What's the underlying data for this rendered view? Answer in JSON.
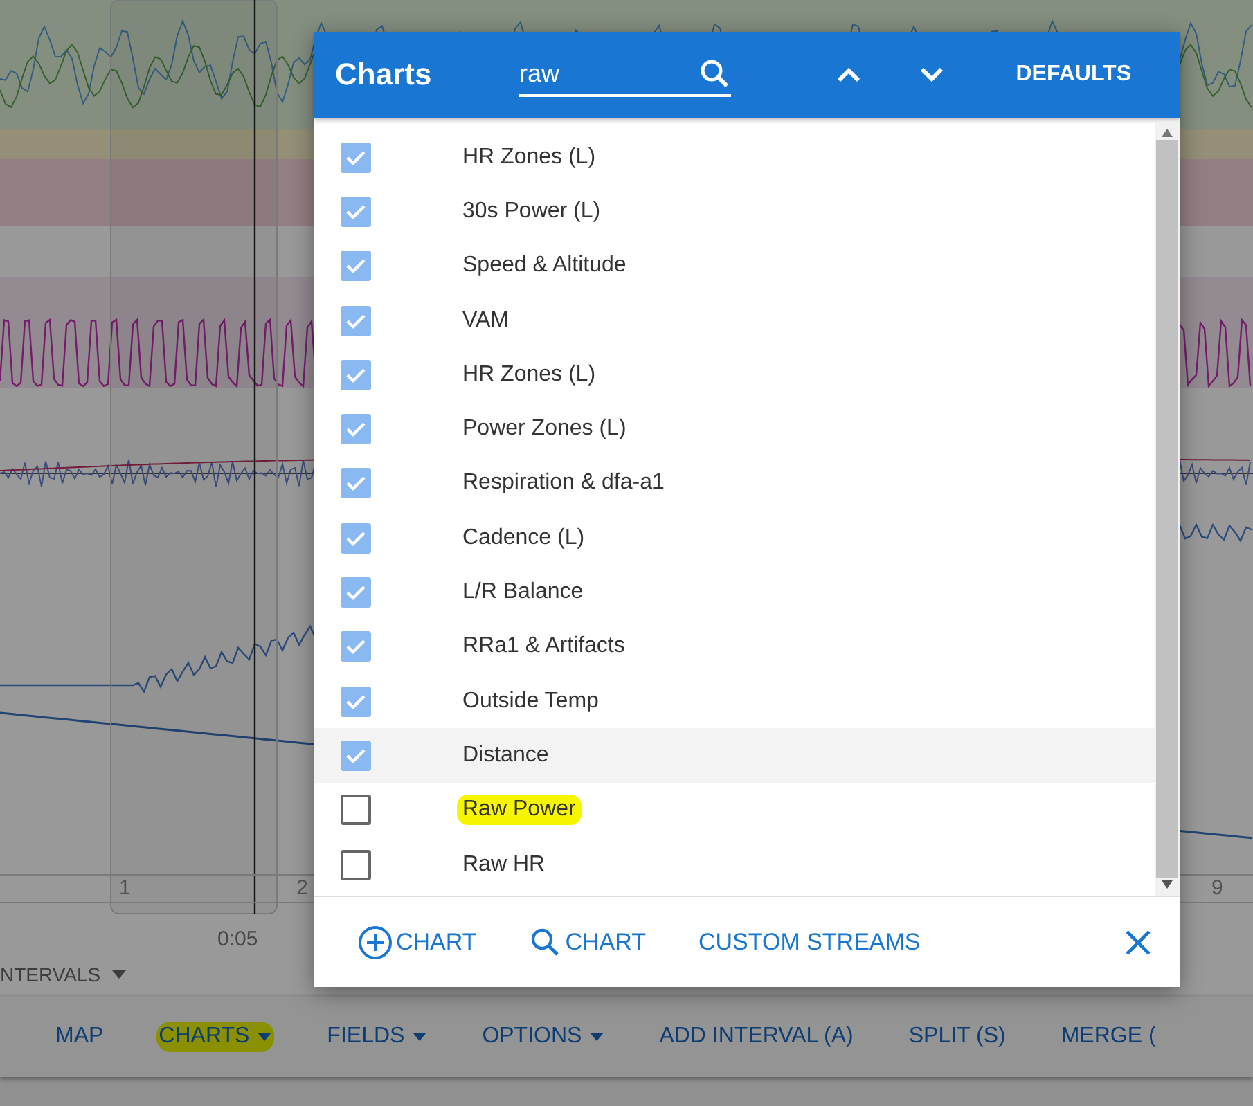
{
  "background": {
    "interval_markers": [
      "1",
      "2",
      "9"
    ],
    "time_tick": "0:05",
    "intervals_menu": "NTERVALS"
  },
  "toolbar": [
    {
      "label": "MAP",
      "dropdown": false,
      "highlighted": false
    },
    {
      "label": "CHARTS",
      "dropdown": true,
      "highlighted": true
    },
    {
      "label": "FIELDS",
      "dropdown": true,
      "highlighted": false
    },
    {
      "label": "OPTIONS",
      "dropdown": true,
      "highlighted": false
    },
    {
      "label": "ADD INTERVAL (A)",
      "dropdown": false,
      "highlighted": false
    },
    {
      "label": "SPLIT (S)",
      "dropdown": false,
      "highlighted": false
    },
    {
      "label": "MERGE (",
      "dropdown": false,
      "highlighted": false
    }
  ],
  "dialog": {
    "title": "Charts",
    "search": {
      "value": "raw"
    },
    "defaults_button": "DEFAULTS",
    "items": [
      {
        "label": "HR Zones (L)",
        "checked": true,
        "hovered": false,
        "highlighted": false
      },
      {
        "label": "30s Power (L)",
        "checked": true,
        "hovered": false,
        "highlighted": false
      },
      {
        "label": "Speed & Altitude",
        "checked": true,
        "hovered": false,
        "highlighted": false
      },
      {
        "label": "VAM",
        "checked": true,
        "hovered": false,
        "highlighted": false
      },
      {
        "label": "HR Zones (L)",
        "checked": true,
        "hovered": false,
        "highlighted": false
      },
      {
        "label": "Power Zones (L)",
        "checked": true,
        "hovered": false,
        "highlighted": false
      },
      {
        "label": "Respiration & dfa-a1",
        "checked": true,
        "hovered": false,
        "highlighted": false
      },
      {
        "label": "Cadence (L)",
        "checked": true,
        "hovered": false,
        "highlighted": false
      },
      {
        "label": "L/R Balance",
        "checked": true,
        "hovered": false,
        "highlighted": false
      },
      {
        "label": "RRa1 & Artifacts",
        "checked": true,
        "hovered": false,
        "highlighted": false
      },
      {
        "label": "Outside Temp",
        "checked": true,
        "hovered": false,
        "highlighted": false
      },
      {
        "label": "Distance",
        "checked": true,
        "hovered": true,
        "highlighted": false
      },
      {
        "label": "Raw Power",
        "checked": false,
        "hovered": false,
        "highlighted": true
      },
      {
        "label": "Raw HR",
        "checked": false,
        "hovered": false,
        "highlighted": false
      }
    ],
    "footer": [
      {
        "kind": "add",
        "label": "CHART"
      },
      {
        "kind": "search",
        "label": "CHART"
      },
      {
        "kind": "text",
        "label": "CUSTOM STREAMS"
      }
    ]
  }
}
